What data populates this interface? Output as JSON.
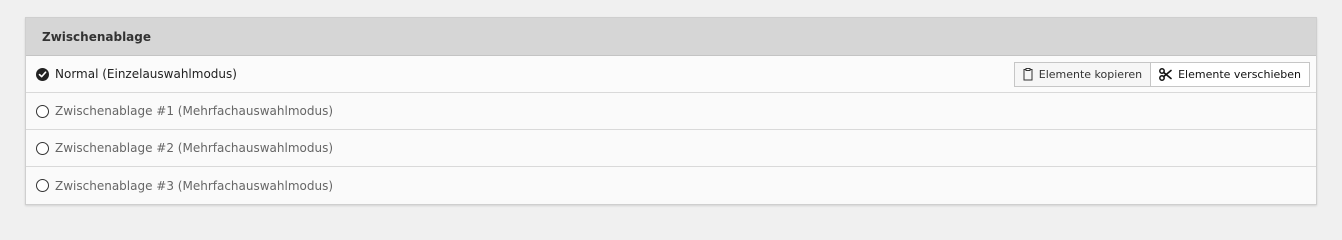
{
  "panel": {
    "title": "Zwischenablage"
  },
  "rows": [
    {
      "label": "Normal (Einzelauswahlmodus)",
      "selected": true
    },
    {
      "label": "Zwischenablage #1 (Mehrfachauswahlmodus)",
      "selected": false
    },
    {
      "label": "Zwischenablage #2 (Mehrfachauswahlmodus)",
      "selected": false
    },
    {
      "label": "Zwischenablage #3 (Mehrfachauswahlmodus)",
      "selected": false
    }
  ],
  "actions": {
    "copy_label": "Elemente kopieren",
    "copy_icon": "clipboard-icon",
    "move_label": "Elemente verschieben",
    "move_icon": "scissors-icon",
    "active": "move"
  },
  "colors": {
    "header_bg": "#d6d6d6",
    "row_bg": "#fafafa",
    "page_bg": "#f0f0f0"
  }
}
